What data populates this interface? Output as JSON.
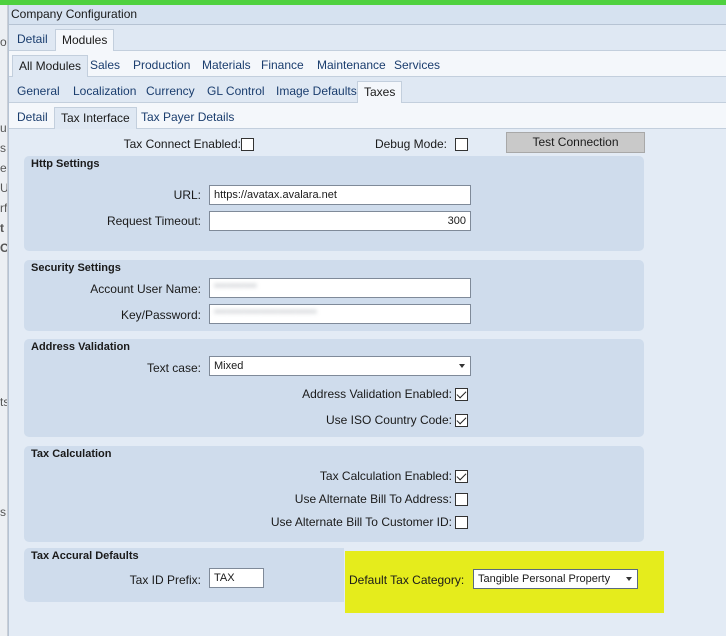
{
  "window": {
    "title": "Company Configuration"
  },
  "left_strip": [
    "on",
    "ur",
    "s",
    "er",
    "U",
    "rf",
    "t",
    "C",
    "ts",
    "s"
  ],
  "tabs_level1": [
    {
      "label": "Detail",
      "active": false
    },
    {
      "label": "Modules",
      "active": true
    }
  ],
  "tabs_level2": [
    {
      "label": "All Modules",
      "active": true
    },
    {
      "label": "Sales",
      "active": false
    },
    {
      "label": "Production",
      "active": false
    },
    {
      "label": "Materials",
      "active": false
    },
    {
      "label": "Finance",
      "active": false
    },
    {
      "label": "Maintenance",
      "active": false
    },
    {
      "label": "Services",
      "active": false
    }
  ],
  "tabs_level3": [
    {
      "label": "General",
      "active": false
    },
    {
      "label": "Localization",
      "active": false
    },
    {
      "label": "Currency",
      "active": false
    },
    {
      "label": "GL Control",
      "active": false
    },
    {
      "label": "Image Defaults",
      "active": false
    },
    {
      "label": "Taxes",
      "active": true
    }
  ],
  "tabs_level4": [
    {
      "label": "Detail",
      "active": false
    },
    {
      "label": "Tax Interface",
      "active": true
    },
    {
      "label": "Tax Payer Details",
      "active": false
    }
  ],
  "top": {
    "tax_connect_label": "Tax Connect Enabled:",
    "tax_connect_checked": false,
    "debug_label": "Debug Mode:",
    "debug_checked": false,
    "test_button": "Test Connection"
  },
  "http": {
    "title": "Http Settings",
    "url_label": "URL:",
    "url_value": "https://avatax.avalara.net",
    "timeout_label": "Request Timeout:",
    "timeout_value": "300"
  },
  "security": {
    "title": "Security Settings",
    "user_label": "Account User Name:",
    "user_value": "**********",
    "key_label": "Key/Password:",
    "key_value": "************************"
  },
  "address": {
    "title": "Address Validation",
    "text_case_label": "Text case:",
    "text_case_value": "Mixed",
    "validation_label": "Address Validation Enabled:",
    "validation_checked": true,
    "iso_label": "Use ISO Country Code:",
    "iso_checked": true
  },
  "calc": {
    "title": "Tax Calculation",
    "enabled_label": "Tax Calculation Enabled:",
    "enabled_checked": true,
    "alt_bill_label": "Use Alternate Bill To Address:",
    "alt_bill_checked": false,
    "alt_cust_label": "Use Alternate Bill To Customer ID:",
    "alt_cust_checked": false
  },
  "accrual": {
    "title": "Tax Accural Defaults",
    "prefix_label": "Tax ID Prefix:",
    "prefix_value": "TAX",
    "category_label": "Default Tax Category:",
    "category_value": "Tangible Personal Property"
  },
  "colors": {
    "highlight": "#e5ec1c",
    "top_bar": "#4fd13f",
    "panel": "#cfdcec"
  }
}
